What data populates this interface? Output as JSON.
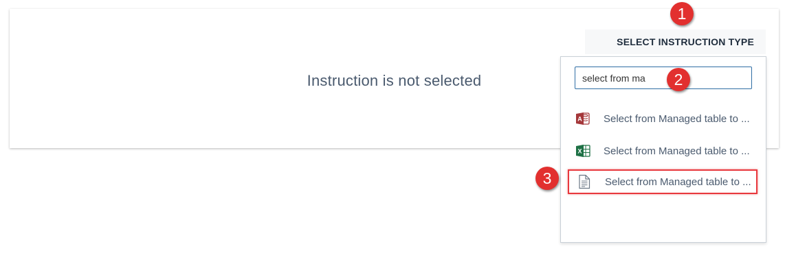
{
  "main": {
    "empty_message": "Instruction is not selected"
  },
  "type_selector": {
    "button_label": "SELECT INSTRUCTION TYPE",
    "search_value": "select from ma",
    "options": [
      {
        "label": "Select from Managed table to ...",
        "icon": "access-icon"
      },
      {
        "label": "Select from Managed table to ...",
        "icon": "excel-icon"
      },
      {
        "label": "Select from Managed table to ...",
        "icon": "text-file-icon"
      }
    ]
  },
  "annotations": {
    "step1": "1",
    "step2": "2",
    "step3": "3"
  },
  "colors": {
    "badge": "#e2302f",
    "highlight_border": "#e8383d",
    "input_border": "#2e6da4",
    "access": "#a4373a",
    "excel": "#1e7145"
  }
}
